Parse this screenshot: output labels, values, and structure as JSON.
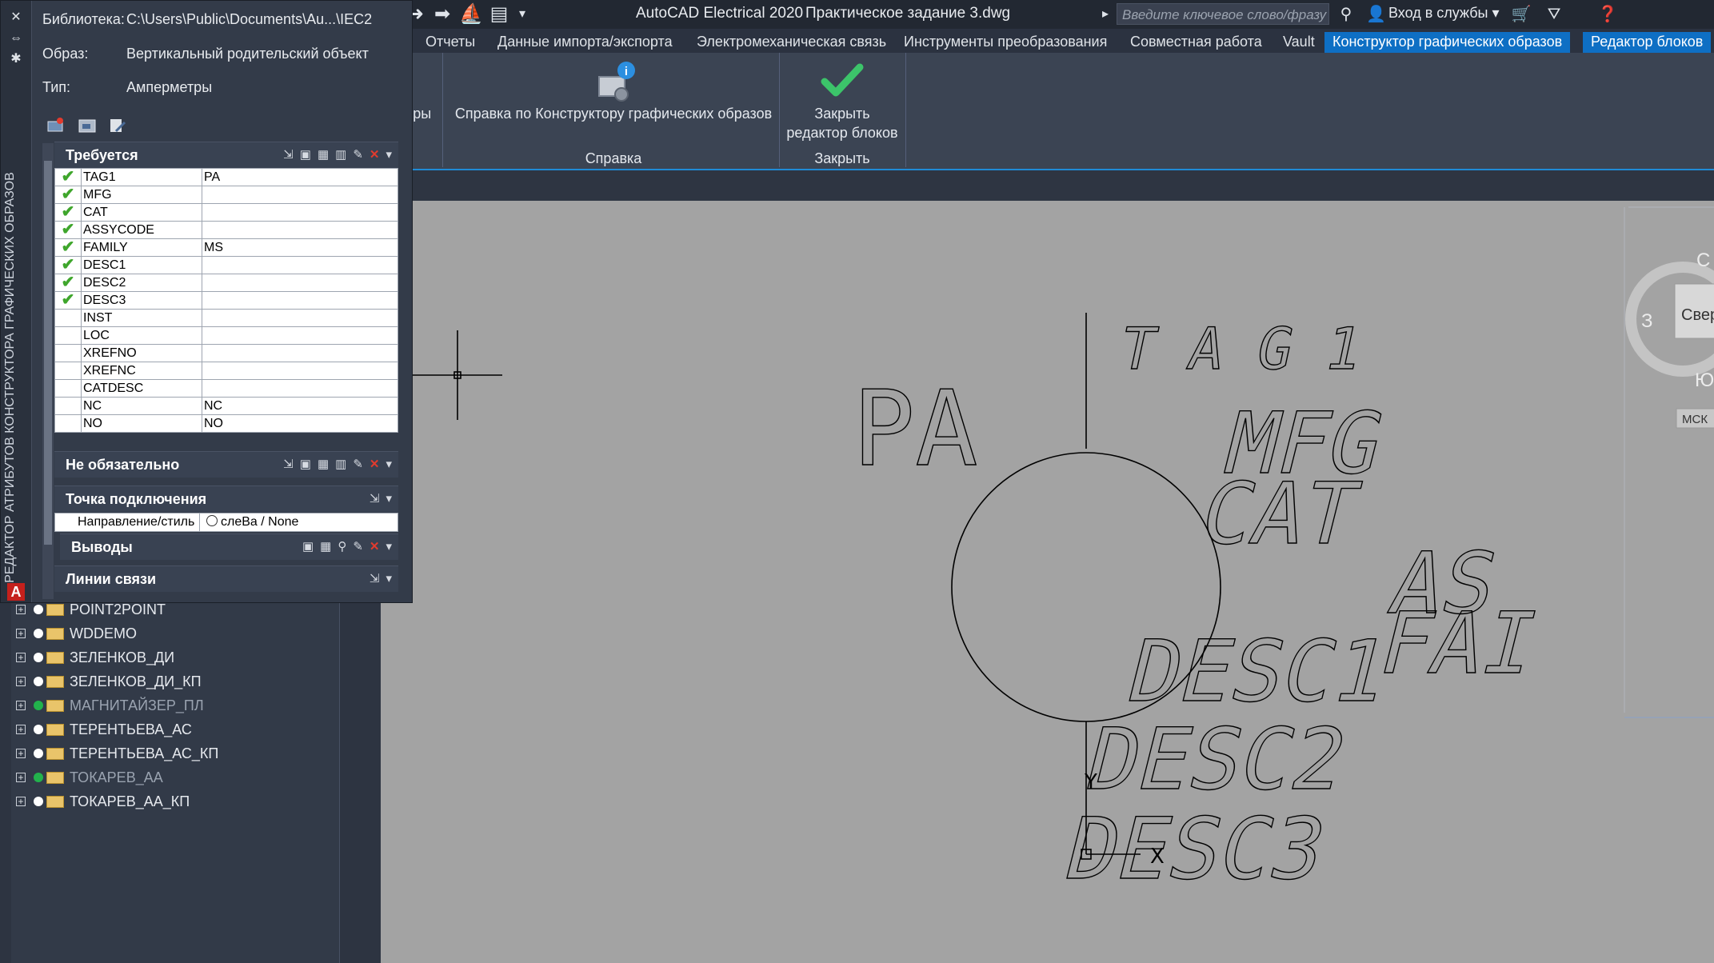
{
  "titlebar": {
    "app_title": "AutoCAD Electrical 2020",
    "file_title": "Практическое задание 3.dwg",
    "search_placeholder": "Введите ключевое слово/фразу",
    "signin_label": "Вход в службы"
  },
  "ribbon_tabs": [
    {
      "label": "Отчеты",
      "active": false
    },
    {
      "label": "Данные импорта/экспорта",
      "active": false
    },
    {
      "label": "Электромеханическая связь",
      "active": false
    },
    {
      "label": "Инструменты преобразования",
      "active": false
    },
    {
      "label": "Совместная работа",
      "active": false
    },
    {
      "label": "Vault",
      "active": false
    },
    {
      "label": "Конструктор графических образов",
      "active": true
    },
    {
      "label": "Редактор блоков",
      "active": true
    }
  ],
  "ribbon": {
    "partial_label": "тры",
    "help_button": "Справка по Конструктору графических образов",
    "help_group": "Справка",
    "close_button_line1": "Закрыть",
    "close_button_line2": "редактор блоков",
    "close_group": "Закрыть"
  },
  "palette": {
    "vertical_title": "РЕДАКТОР АТРИБУТОВ КОНСТРУКТОРА ГРАФИЧЕСКИХ ОБРАЗОВ",
    "library_label": "Библиотека:",
    "library_value": "C:\\Users\\Public\\Documents\\Au...\\IEC2",
    "image_label": "Образ:",
    "image_value": "Вертикальный родительский объект",
    "type_label": "Тип:",
    "type_value": "Амперметры",
    "sections": {
      "required": "Требуется",
      "optional": "Не обязательно",
      "connection": "Точка подключения",
      "pins": "Выводы",
      "links": "Линии связи"
    },
    "required_rows": [
      {
        "name": "TAG1",
        "value": "PA",
        "checked": true
      },
      {
        "name": "MFG",
        "value": "",
        "checked": true
      },
      {
        "name": "CAT",
        "value": "",
        "checked": true
      },
      {
        "name": "ASSYCODE",
        "value": "",
        "checked": true
      },
      {
        "name": "FAMILY",
        "value": "MS",
        "checked": true
      },
      {
        "name": "DESC1",
        "value": "",
        "checked": true
      },
      {
        "name": "DESC2",
        "value": "",
        "checked": true
      },
      {
        "name": "DESC3",
        "value": "",
        "checked": true
      },
      {
        "name": "INST",
        "value": "",
        "checked": false
      },
      {
        "name": "LOC",
        "value": "",
        "checked": false
      },
      {
        "name": "XREFNO",
        "value": "",
        "checked": false
      },
      {
        "name": "XREFNC",
        "value": "",
        "checked": false
      },
      {
        "name": "CATDESC",
        "value": "",
        "checked": false
      },
      {
        "name": "NC",
        "value": "NC",
        "checked": false
      },
      {
        "name": "NO",
        "value": "NO",
        "checked": false
      }
    ],
    "connection_label": "Направление/стиль",
    "connection_value": "слеВа / None"
  },
  "tree_items": [
    {
      "label": "POINT2POINT",
      "dot": "white",
      "dim": false
    },
    {
      "label": "WDDEMO",
      "dot": "white",
      "dim": false
    },
    {
      "label": "ЗЕЛЕНКОВ_ДИ",
      "dot": "white",
      "dim": false
    },
    {
      "label": "ЗЕЛЕНКОВ_ДИ_КП",
      "dot": "white",
      "dim": false
    },
    {
      "label": "МАГНИТАЙЗЕР_ПЛ",
      "dot": "green",
      "dim": true
    },
    {
      "label": "ТЕРЕНТЬЕВА_АС",
      "dot": "white",
      "dim": false
    },
    {
      "label": "ТЕРЕНТЬЕВА_АС_КП",
      "dot": "white",
      "dim": false
    },
    {
      "label": "ТОКАРЕВ_АА",
      "dot": "green",
      "dim": true
    },
    {
      "label": "ТОКАРЕВ_АА_КП",
      "dot": "white",
      "dim": false
    }
  ],
  "drawing": {
    "symbol_text": "PA",
    "attributes": [
      "TAG1",
      "MFG",
      "CAT",
      "DESC1",
      "DESC2",
      "DESC3"
    ],
    "right_partial": [
      "AS",
      "FAI"
    ],
    "ucs_y": "Y",
    "ucs_x": "X"
  },
  "viewcube": {
    "face": "Свер",
    "north": "С",
    "west": "З",
    "south": "Ю",
    "wcs": "МСК"
  },
  "colors": {
    "accent": "#0e6fc4",
    "check": "#3fa62c",
    "close_check": "#3cc46a",
    "delete": "#e23b2e"
  }
}
